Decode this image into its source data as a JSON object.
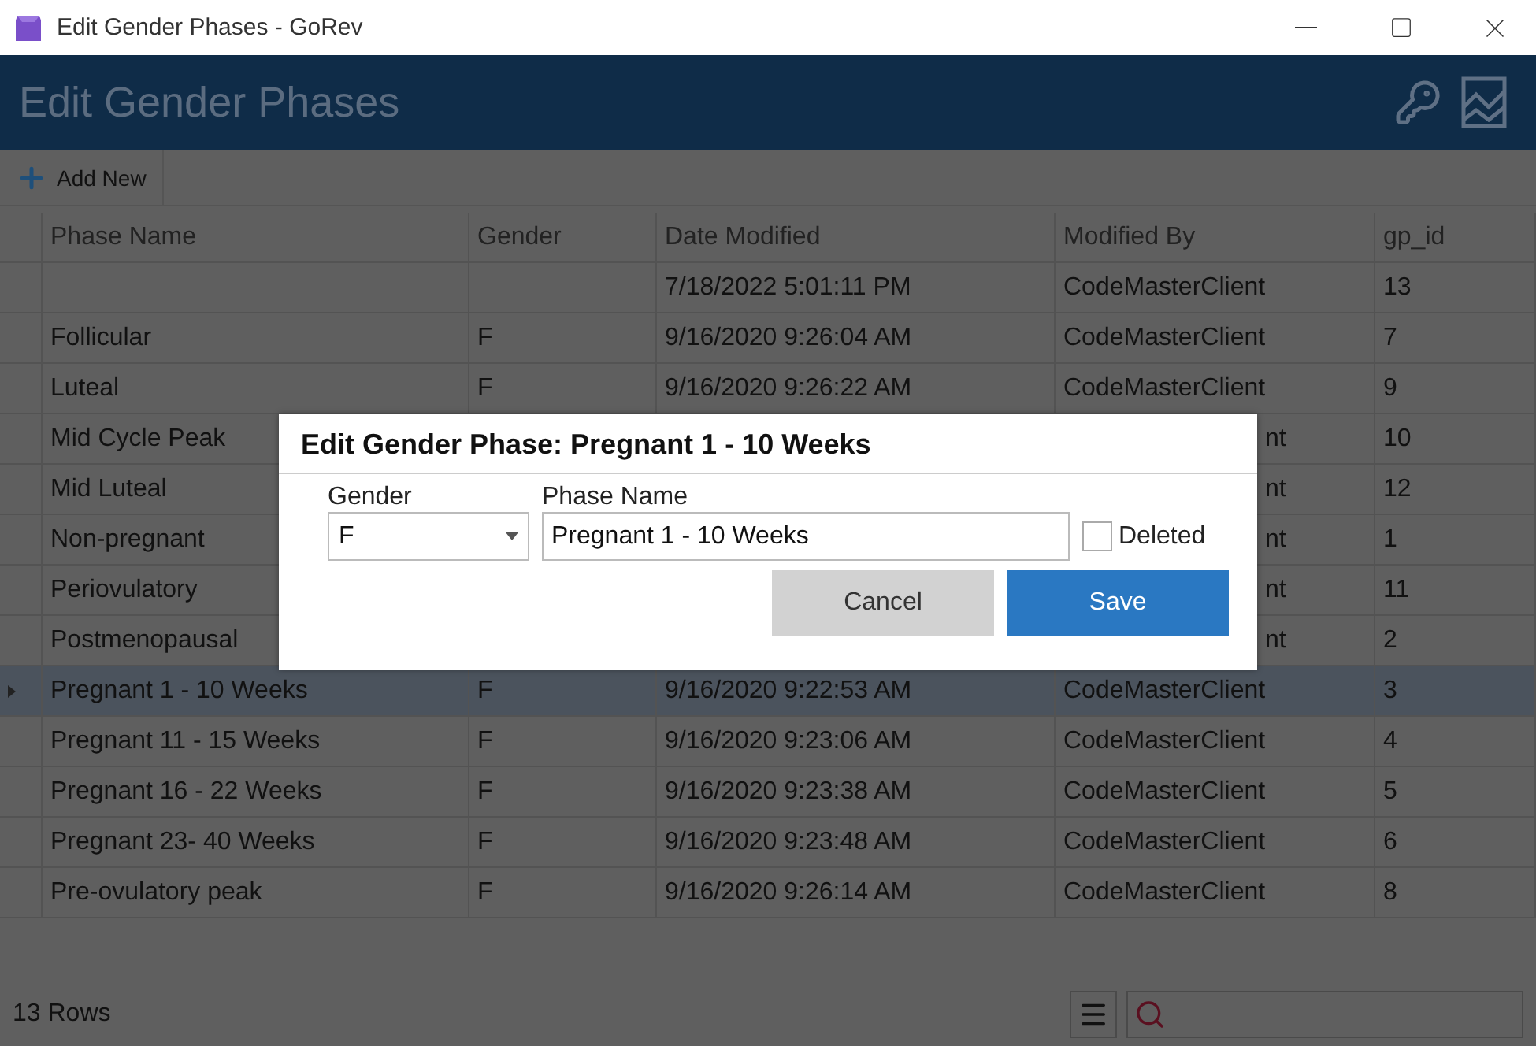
{
  "window": {
    "title": "Edit Gender Phases - GoRev"
  },
  "header": {
    "title": "Edit Gender Phases"
  },
  "toolbar": {
    "add_button": "Add New"
  },
  "table": {
    "columns": [
      "Phase Name",
      "Gender",
      "Date Modified",
      "Modified By",
      "gp_id"
    ],
    "rows": [
      {
        "cells": [
          null,
          null,
          "7/18/2022 5:01:11 PM",
          "CodeMasterClient",
          "13"
        ],
        "selected": false
      },
      {
        "cells": [
          "Follicular",
          "F",
          "9/16/2020 9:26:04 AM",
          "CodeMasterClient",
          "7"
        ],
        "selected": false
      },
      {
        "cells": [
          "Luteal",
          "F",
          "9/16/2020 9:26:22 AM",
          "CodeMasterClient",
          "9"
        ],
        "selected": false
      },
      {
        "cells": [
          "Mid Cycle Peak",
          null,
          null,
          "nt",
          "10"
        ],
        "selected": false
      },
      {
        "cells": [
          "Mid Luteal",
          null,
          null,
          "nt",
          "12"
        ],
        "selected": false
      },
      {
        "cells": [
          "Non-pregnant",
          null,
          null,
          "nt",
          "1"
        ],
        "selected": false
      },
      {
        "cells": [
          "Periovulatory",
          null,
          null,
          "nt",
          "11"
        ],
        "selected": false
      },
      {
        "cells": [
          "Postmenopausal",
          null,
          null,
          "nt",
          "2"
        ],
        "selected": false
      },
      {
        "cells": [
          "Pregnant 1 - 10 Weeks",
          "F",
          "9/16/2020 9:22:53 AM",
          "CodeMasterClient",
          "3"
        ],
        "selected": true
      },
      {
        "cells": [
          "Pregnant 11 - 15 Weeks",
          "F",
          "9/16/2020 9:23:06 AM",
          "CodeMasterClient",
          "4"
        ],
        "selected": false
      },
      {
        "cells": [
          "Pregnant 16 - 22 Weeks",
          "F",
          "9/16/2020 9:23:38 AM",
          "CodeMasterClient",
          "5"
        ],
        "selected": false
      },
      {
        "cells": [
          "Pregnant 23- 40 Weeks",
          "F",
          "9/16/2020 9:23:48 AM",
          "CodeMasterClient",
          "6"
        ],
        "selected": false
      },
      {
        "cells": [
          "Pre-ovulatory peak",
          "F",
          "9/16/2020 9:26:14 AM",
          "CodeMasterClient",
          "8"
        ],
        "selected": false
      }
    ]
  },
  "status_bar": {
    "row_count": "13 Rows"
  },
  "dialog": {
    "title": "Edit Gender Phase: Pregnant 1 - 10 Weeks",
    "gender_label": "Gender",
    "gender_value": "F",
    "phase_label": "Phase Name",
    "phase_value": "Pregnant 1 - 10 Weeks",
    "deleted": {
      "label": "Deleted",
      "checked": false
    },
    "buttons": [
      {
        "label": "Cancel",
        "kind": "secondary"
      },
      {
        "label": "Save",
        "kind": "primary"
      }
    ]
  }
}
